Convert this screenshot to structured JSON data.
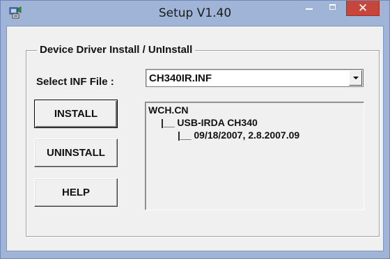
{
  "window": {
    "title": "Setup V1.40",
    "close_glyph": "✕"
  },
  "icons": {
    "app": "setup-app-icon",
    "minimize": "minimize-icon",
    "maximize": "maximize-icon",
    "close": "close-icon",
    "dropdown": "chevron-down-icon"
  },
  "colors": {
    "titlebar": "#9fb4d6",
    "close_button": "#c7463b",
    "dialog_background": "#f0f0f0"
  },
  "group": {
    "title": "Device Driver Install / UnInstall"
  },
  "inf": {
    "label": "Select INF File :",
    "selected": "CH340IR.INF"
  },
  "buttons": {
    "install": "INSTALL",
    "uninstall": "UNINSTALL",
    "help": "HELP"
  },
  "info": {
    "lines": [
      "WCH.CN",
      "|__ USB-IRDA CH340",
      "|__ 09/18/2007, 2.8.2007.09"
    ]
  }
}
